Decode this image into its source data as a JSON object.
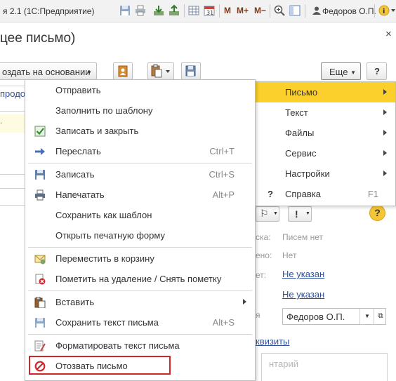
{
  "titlebar": {
    "title": "я 2.1   (1С:Предприятие)",
    "m_labels": [
      "M",
      "M+",
      "M−"
    ],
    "user": "Федоров О.П."
  },
  "form": {
    "title": "цее письмо)",
    "close_glyph": "×",
    "create_based_on": "оздать на основании",
    "more_label": "Еще",
    "help_label": "?",
    "link_prod": "продо",
    "strip_text": ".",
    "flag_glyph": "⚐",
    "excl_glyph": "!",
    "help_circle": "?",
    "fields": [
      {
        "label": "ска:",
        "value": "Писем нет"
      },
      {
        "label": "ено:",
        "value": "Нет"
      },
      {
        "label": "ет:",
        "value": "Не указан"
      },
      {
        "label": "",
        "value": "Не указан"
      },
      {
        "label": "я",
        "value": "Федоров О.П."
      }
    ],
    "requisites_link": "квизиты",
    "comment_placeholder": "нтарий"
  },
  "menu": {
    "items": [
      {
        "label": "Отправить",
        "shortcut": "",
        "icon": "none"
      },
      {
        "label": "Заполнить по шаблону",
        "shortcut": "",
        "icon": "none"
      },
      {
        "label": "Записать и закрыть",
        "shortcut": "",
        "icon": "save-close-icon"
      },
      {
        "label": "Переслать",
        "shortcut": "Ctrl+T",
        "icon": "forward-arrow-icon"
      },
      {
        "label": "Записать",
        "shortcut": "Ctrl+S",
        "icon": "floppy-disk-icon"
      },
      {
        "label": "Напечатать",
        "shortcut": "Alt+P",
        "icon": "printer-icon"
      },
      {
        "label": "Сохранить как шаблон",
        "shortcut": "",
        "icon": "none"
      },
      {
        "label": "Открыть печатную форму",
        "shortcut": "",
        "icon": "none"
      },
      {
        "label": "Переместить в корзину",
        "shortcut": "",
        "icon": "move-to-trash-icon"
      },
      {
        "label": "Пометить на удаление / Снять пометку",
        "shortcut": "",
        "icon": "mark-delete-icon"
      },
      {
        "label": "Вставить",
        "shortcut": "",
        "icon": "paste-icon"
      },
      {
        "label": "Сохранить текст письма",
        "shortcut": "Alt+S",
        "icon": "save-text-icon"
      },
      {
        "label": "Форматировать текст письма",
        "shortcut": "",
        "icon": "format-text-icon"
      },
      {
        "label": "Отозвать письмо",
        "shortcut": "",
        "icon": "revoke-icon"
      }
    ]
  },
  "submenu": {
    "items": [
      {
        "label": "Письмо",
        "shortcut": "",
        "active": true
      },
      {
        "label": "Текст",
        "shortcut": ""
      },
      {
        "label": "Файлы",
        "shortcut": ""
      },
      {
        "label": "Сервис",
        "shortcut": ""
      },
      {
        "label": "Настройки",
        "shortcut": ""
      },
      {
        "label": "Справка",
        "shortcut": "F1",
        "icon_glyph": "?"
      }
    ]
  },
  "colors": {
    "active_item": "#fbd02c",
    "highlight_border": "#d0262b",
    "link": "#2f4f9a"
  }
}
